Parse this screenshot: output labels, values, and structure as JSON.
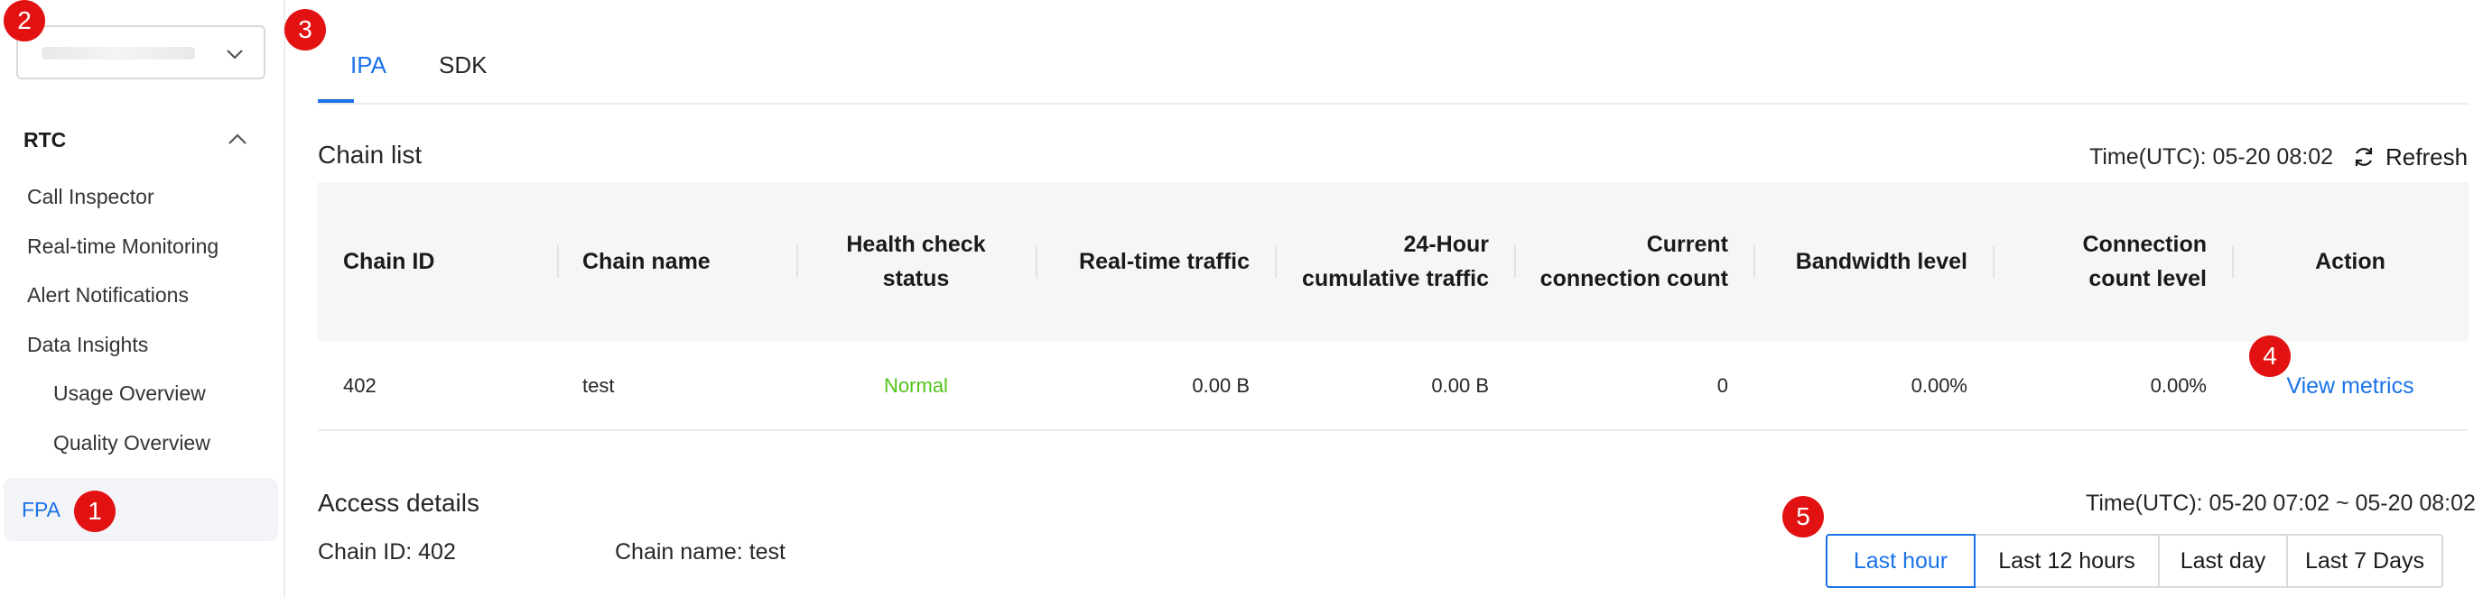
{
  "sidebar": {
    "project_select_value": "",
    "group": {
      "label": "RTC"
    },
    "items": [
      {
        "label": "Call Inspector"
      },
      {
        "label": "Real-time Monitoring"
      },
      {
        "label": "Alert Notifications"
      },
      {
        "label": "Data Insights"
      },
      {
        "label": "Usage Overview"
      },
      {
        "label": "Quality Overview"
      },
      {
        "label": "FPA"
      }
    ]
  },
  "tabs": [
    {
      "label": "IPA"
    },
    {
      "label": "SDK"
    }
  ],
  "chain_list": {
    "title": "Chain list",
    "time_text": "Time(UTC): 05-20 08:02",
    "refresh_label": "Refresh",
    "columns": [
      "Chain ID",
      "Chain name",
      "Health check status",
      "Real-time traffic",
      "24-Hour cumulative traffic",
      "Current connection count",
      "Bandwidth level",
      "Connection count level",
      "Action"
    ],
    "rows": [
      {
        "chain_id": "402",
        "chain_name": "test",
        "health": "Normal",
        "realtime_traffic": "0.00 B",
        "cumulative_traffic": "0.00 B",
        "connection_count": "0",
        "bandwidth_level": "0.00%",
        "connection_level": "0.00%",
        "action": "View metrics"
      }
    ]
  },
  "access_details": {
    "title": "Access details",
    "time_text": "Time(UTC): 05-20 07:02 ~ 05-20 08:02",
    "chain_id_text": "Chain ID: 402",
    "chain_name_text": "Chain name: test",
    "ranges": [
      {
        "label": "Last hour",
        "selected": true
      },
      {
        "label": "Last 12 hours"
      },
      {
        "label": "Last day"
      },
      {
        "label": "Last 7 Days"
      }
    ]
  },
  "badges": [
    "1",
    "2",
    "3",
    "4",
    "5"
  ],
  "colors": {
    "accent": "#1a73e8",
    "success": "#52c41a",
    "badge": "#e31212"
  }
}
